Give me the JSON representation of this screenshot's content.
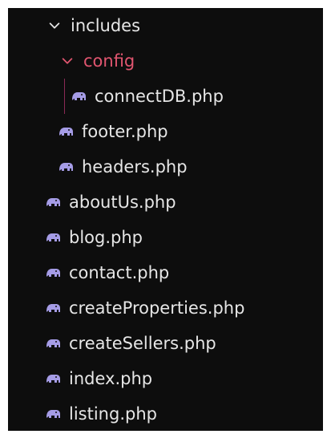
{
  "explorer": {
    "colors": {
      "background": "#0d0d0d",
      "text": "#e6e6e6",
      "config_folder": "#e0556f",
      "php_icon": "#a59ce6",
      "indent_guide": "#8b2a55"
    },
    "folders": {
      "includes": {
        "label": "includes",
        "icon": "chevron-down-icon"
      },
      "config": {
        "label": "config",
        "icon": "chevron-down-icon"
      }
    },
    "files": {
      "connectDB": "connectDB.php",
      "footer": "footer.php",
      "headers": "headers.php",
      "aboutUs": "aboutUs.php",
      "blog": "blog.php",
      "contact": "contact.php",
      "createProperties": "createProperties.php",
      "createSellers": "createSellers.php",
      "index": "index.php",
      "listing": "listing.php"
    },
    "file_icon": "php-elephant-icon"
  }
}
